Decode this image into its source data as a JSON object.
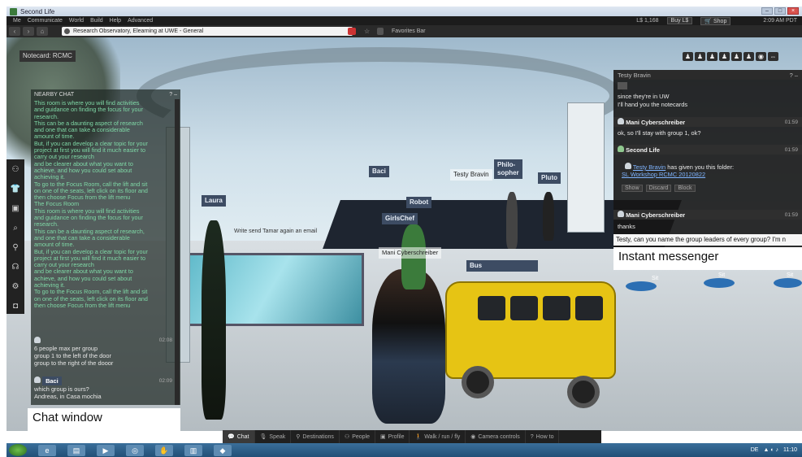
{
  "window": {
    "title": "Second Life"
  },
  "menu": {
    "items": [
      "Me",
      "Communicate",
      "World",
      "Build",
      "Help",
      "Advanced"
    ],
    "balance": "L$ 1,168",
    "buy_label": "Buy L$",
    "shop_label": "Shop",
    "clock": "2:09 AM PDT"
  },
  "nav": {
    "location": "Research Observatory, Elearning at UWE - General",
    "favorites_label": "Favorites Bar"
  },
  "notecard_tab": "Notecard: RCMC",
  "nearby_chat": {
    "title": "NEARBY CHAT",
    "lines": [
      "This room is where you will find activities",
      "and guidance on finding the focus for your",
      "research.",
      "This can be a daunting aspect of research",
      "and one that can take a considerable",
      "amount of time.",
      "But, if you can develop a clear topic for your",
      "project at first you will find it much easier to",
      "carry out your research",
      "and be clearer about what you want to",
      "achieve, and how you could set about",
      "achieving it.",
      "To go to the Focus Room, call the lift and sit",
      "on one of the seats, left click on its floor and",
      "then choose Focus from the lift menu",
      "The Focus Room",
      "This room is where you will find activities",
      "and guidance on finding the focus for your",
      "research.",
      "This can be a daunting aspect of research,",
      "and one that can take a considerable",
      "amount of time.",
      "But, if you can develop a clear topic for your",
      "project at first you will find it much easier to",
      "carry out your research",
      "and be clearer about what you want to",
      "achieve, and how you could set about",
      "achieving it.",
      "To go to the Focus Room, call the lift and sit",
      "on one of the seats, left click on its floor and",
      "then choose Focus from the lift menu"
    ],
    "msg1": {
      "time": "02:08",
      "lines": [
        "6 people max per group",
        "group 1 to the left of the door",
        "group to the right of the dooor"
      ]
    },
    "msg2": {
      "name": "Baci",
      "time": "02:09",
      "lines": [
        "which group is ours?",
        "Andreas, in Casa mochia"
      ]
    },
    "caption": "Chat window"
  },
  "scene": {
    "tags": {
      "laura": "Laura",
      "baci": "Baci",
      "testy": "Testy Bravin",
      "philosopher": "Philo-\nsopher",
      "pluto": "Pluto",
      "robot": "Robot",
      "girlschef": "GirlsChef",
      "mani": "Mani Cyberschreiber",
      "bus": "Bus",
      "sit1": "Sit",
      "sit2": "Sit",
      "sit3": "Sit"
    },
    "floating_text": "Write send Tamar again an email"
  },
  "im": {
    "title": "Testy Bravin",
    "lines_top": [
      "since they're in UW",
      "I'll hand you the notecards"
    ],
    "mani1": {
      "name": "Mani Cyberschreiber",
      "time": "01:59",
      "text": "ok, so I'll stay with group 1, ok?"
    },
    "sl": {
      "name": "Second Life",
      "time": "01:59",
      "given_by": "Testy Bravin",
      "given_text": "has given you this folder:",
      "folder": "SL Workshop RCMC 20120822",
      "btn_show": "Show",
      "btn_discard": "Discard",
      "btn_block": "Block"
    },
    "mani2": {
      "name": "Mani Cyberschreiber",
      "time": "01:59",
      "text": "thanks"
    },
    "input_value": "Testy, can you name the group leaders of every group? I'm n",
    "caption": "Instant messenger"
  },
  "bottom_bar": {
    "chat": "Chat",
    "speak": "Speak",
    "destinations": "Destinations",
    "people": "People",
    "profile": "Profile",
    "walk": "Walk / run / fly",
    "camera": "Camera controls",
    "howto": "How to"
  },
  "taskbar": {
    "lang": "DE",
    "time": "11:10"
  },
  "colors": {
    "chat_text": "#7fd8a6",
    "name_tag_bg": "#3d4c63",
    "bus_yellow": "#e6c414"
  }
}
